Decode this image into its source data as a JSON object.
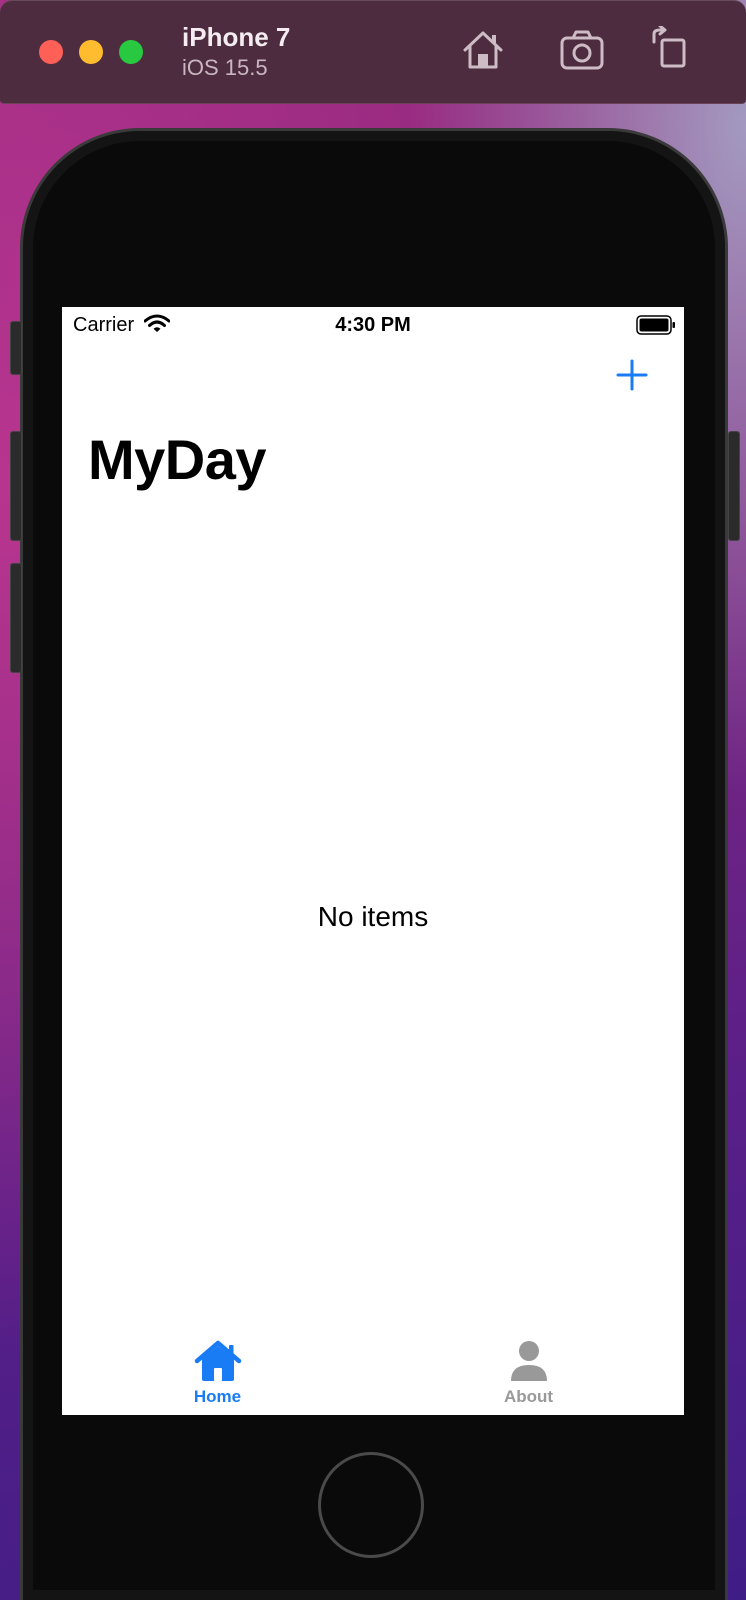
{
  "window": {
    "device_name": "iPhone 7",
    "os_version": "iOS 15.5",
    "toolbar_icons": [
      "home-icon",
      "screenshot-icon",
      "rotate-icon"
    ]
  },
  "status_bar": {
    "carrier": "Carrier",
    "time": "4:30 PM",
    "battery_level": 1.0
  },
  "nav": {
    "title": "MyDay",
    "add_icon": "plus-icon"
  },
  "content": {
    "empty_message": "No items"
  },
  "tab_bar": {
    "tabs": [
      {
        "label": "Home",
        "icon": "house-fill-icon",
        "selected": true
      },
      {
        "label": "About",
        "icon": "person-fill-icon",
        "selected": false
      }
    ]
  },
  "colors": {
    "accent": "#1a7cf5",
    "inactive": "#999999",
    "titlebar": "#4d2c3f"
  }
}
